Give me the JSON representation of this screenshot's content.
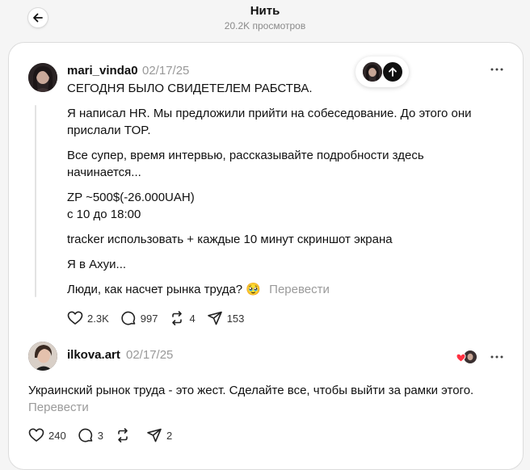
{
  "header": {
    "title": "Нить",
    "views": "20.2K просмотров"
  },
  "main_post": {
    "username": "mari_vinda0",
    "date": "02/17/25",
    "paragraphs": {
      "p1": "СЕГОДНЯ БЫЛО СВИДЕТЕЛЕМ РАБСТВА.",
      "p2": "Я написал HR. Мы предложили прийти на собеседование. До этого они прислали TOP.",
      "p3": "Все супер, время интервью, рассказывайте подробности здесь начинается...",
      "p4_line1": "ZP ~500$(-26.000UAH)",
      "p4_line2": "с 10 до 18:00",
      "p5": "tracker использовать + каждые 10 минут скриншот экрана",
      "p6": "Я в Ахуи...",
      "p7": "Люди, как насчет рынка труда? 🥹"
    },
    "translate_label": "Перевести",
    "stats": {
      "likes": "2.3K",
      "comments": "997",
      "reposts": "4",
      "shares": "153"
    }
  },
  "reply": {
    "username": "ilkova.art",
    "date": "02/17/25",
    "text": "Украинский рынок труда - это жест. Сделайте все, чтобы выйти за рамки этого.",
    "translate_label": "Перевести",
    "stats": {
      "likes": "240",
      "comments": "3",
      "reposts": "",
      "shares": "2"
    }
  },
  "colors": {
    "background": "#f5f5f5",
    "card": "#ffffff",
    "text": "#101010",
    "muted": "#999999",
    "heart_red": "#ff3040"
  }
}
